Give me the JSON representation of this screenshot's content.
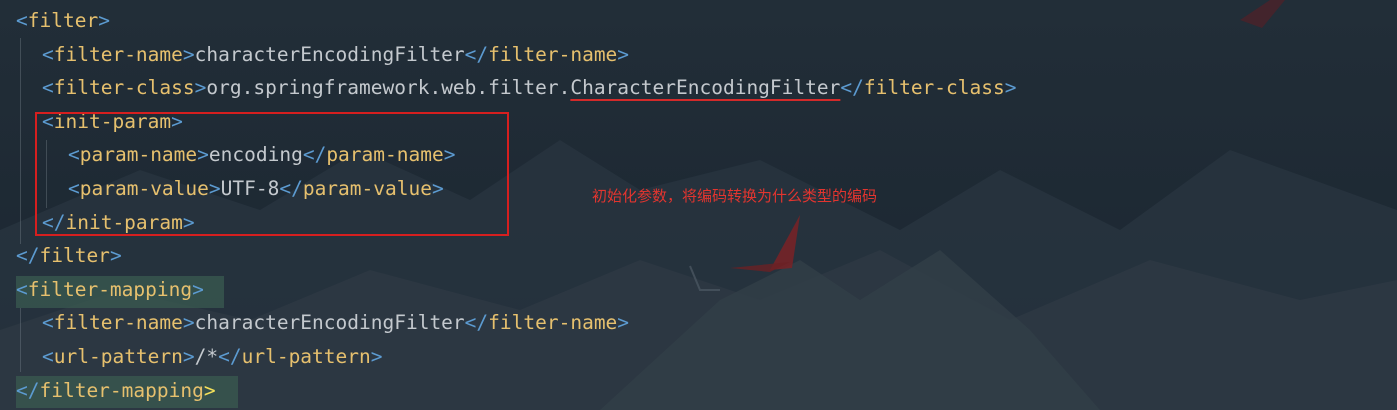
{
  "code": {
    "lines": [
      {
        "indent": 0,
        "open": "<",
        "tag": "filter",
        "close": ">"
      },
      {
        "indent": 1,
        "open": "<",
        "tag": "filter-name",
        "close": ">",
        "text": "characterEncodingFilter",
        "end_open": "</",
        "end_tag": "filter-name",
        "end_close": ">"
      },
      {
        "indent": 1,
        "open": "<",
        "tag": "filter-class",
        "close": ">",
        "text": "org.springframework.web.filter.",
        "class_name": "CharacterEncodingFilter",
        "end_open": "</",
        "end_tag": "filter-class",
        "end_close": ">"
      },
      {
        "indent": 1,
        "open": "<",
        "tag": "init-param",
        "close": ">"
      },
      {
        "indent": 2,
        "open": "<",
        "tag": "param-name",
        "close": ">",
        "text": "encoding",
        "end_open": "</",
        "end_tag": "param-name",
        "end_close": ">"
      },
      {
        "indent": 2,
        "open": "<",
        "tag": "param-value",
        "close": ">",
        "text": "UTF-8",
        "end_open": "</",
        "end_tag": "param-value",
        "end_close": ">"
      },
      {
        "indent": 1,
        "open": "</",
        "tag": "init-param",
        "close": ">"
      },
      {
        "indent": 0,
        "open": "</",
        "tag": "filter",
        "close": ">"
      },
      {
        "indent": 0,
        "open": "<",
        "tag": "filter-mapping",
        "close": ">"
      },
      {
        "indent": 1,
        "open": "<",
        "tag": "filter-name",
        "close": ">",
        "text": "characterEncodingFilter",
        "end_open": "</",
        "end_tag": "filter-name",
        "end_close": ">"
      },
      {
        "indent": 1,
        "open": "<",
        "tag": "url-pattern",
        "close": ">",
        "text": "/*",
        "end_open": "</",
        "end_tag": "url-pattern",
        "end_close": ">"
      },
      {
        "indent": 0,
        "open": "</",
        "tag": "filter-mapping",
        "close": ">"
      }
    ]
  },
  "annotation": {
    "text": "初始化参数，将编码转换为什么类型的编码",
    "color": "#e2352f"
  },
  "colors": {
    "tag": "#e6c06e",
    "bracket": "#5c9bd1",
    "text": "#c4c9ce",
    "highlight": "#3a5c50",
    "box": "#d61f1f"
  }
}
